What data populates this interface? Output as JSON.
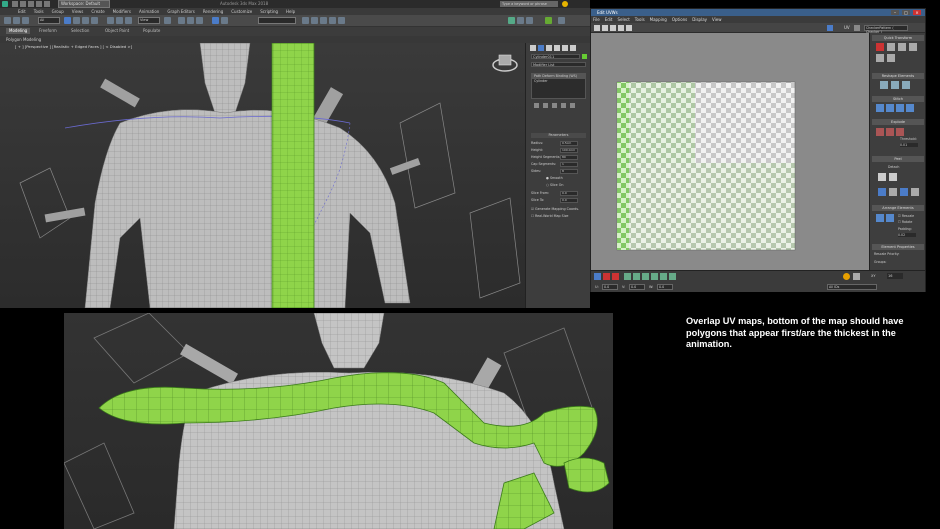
{
  "max": {
    "workspace": "Workspace: Default",
    "title": "Autodesk 3ds Max 2018",
    "search_placeholder": "Type a keyword or phrase",
    "menu": [
      "Edit",
      "Tools",
      "Group",
      "Views",
      "Create",
      "Modifiers",
      "Animation",
      "Graph Editors",
      "Rendering",
      "Customize",
      "Scripting",
      "Help"
    ],
    "toolbar_dropdown_selection": "All",
    "toolbar_dropdown_view": "View",
    "ribbon_tabs": [
      "Modeling",
      "Freeform",
      "Selection",
      "Object Paint",
      "Populate"
    ],
    "active_ribbon_tab": "Modeling",
    "sub_ribbon": "Polygon Modeling",
    "viewport_label": "[ + ] [Perspective ] [Realistic + Edged Faces ] [ < Disabled >]",
    "command_panel": {
      "object_name": "Cylinder011",
      "modifier_list": "Modifier List",
      "stack": [
        "Path Deform Binding (WS)",
        "Cylinder"
      ],
      "rollout": "Parameters",
      "params": [
        {
          "label": "Radius:",
          "value": "0.5cm"
        },
        {
          "label": "Height:",
          "value": "100.0cm"
        },
        {
          "label": "Height Segments:",
          "value": "80"
        },
        {
          "label": "Cap Segments:",
          "value": "1"
        },
        {
          "label": "Sides:",
          "value": "8"
        }
      ],
      "checks": [
        "Smooth",
        "Slice On"
      ],
      "slice_params": [
        {
          "label": "Slice From:",
          "value": "0.0"
        },
        {
          "label": "Slice To:",
          "value": "0.0"
        }
      ],
      "options": [
        "Generate Mapping Coords.",
        "Real-World Map Size"
      ]
    }
  },
  "uv": {
    "title": "Edit UVWs",
    "menu": [
      "File",
      "Edit",
      "Select",
      "Tools",
      "Mapping",
      "Options",
      "Display",
      "View"
    ],
    "uv_label": "UV",
    "checker_dropdown": "CheckerPattern ( Checker )",
    "sections": [
      "Quick Transform",
      "Reshape Elements",
      "Stitch",
      "Explode",
      "Peel",
      "Arrange Elements",
      "Element Properties"
    ],
    "peel_labels": [
      "Detach"
    ],
    "arrange_checks": [
      "Rescale",
      "Rotate"
    ],
    "padding_label": "Padding:",
    "padding_value": "0.02",
    "threshold_label": "Threshold:",
    "threshold_value": "0.01",
    "rescale_priority_label": "Rescale Priority:",
    "groups_label": "Groups:",
    "bottom": {
      "u_label": "U:",
      "u_value": "0.0",
      "v_label": "V:",
      "v_value": "0.0",
      "w_label": "W:",
      "w_value": "0.0",
      "all_ids": "All IDs",
      "xy": "XY",
      "zoom": "16"
    }
  },
  "caption": "Overlap UV maps, bottom of the map should have polygons that appear first/are the thickest in the animation.",
  "colors": {
    "green_mesh": "#8fd44a",
    "uv_blue_title": "#3a5f8a"
  }
}
